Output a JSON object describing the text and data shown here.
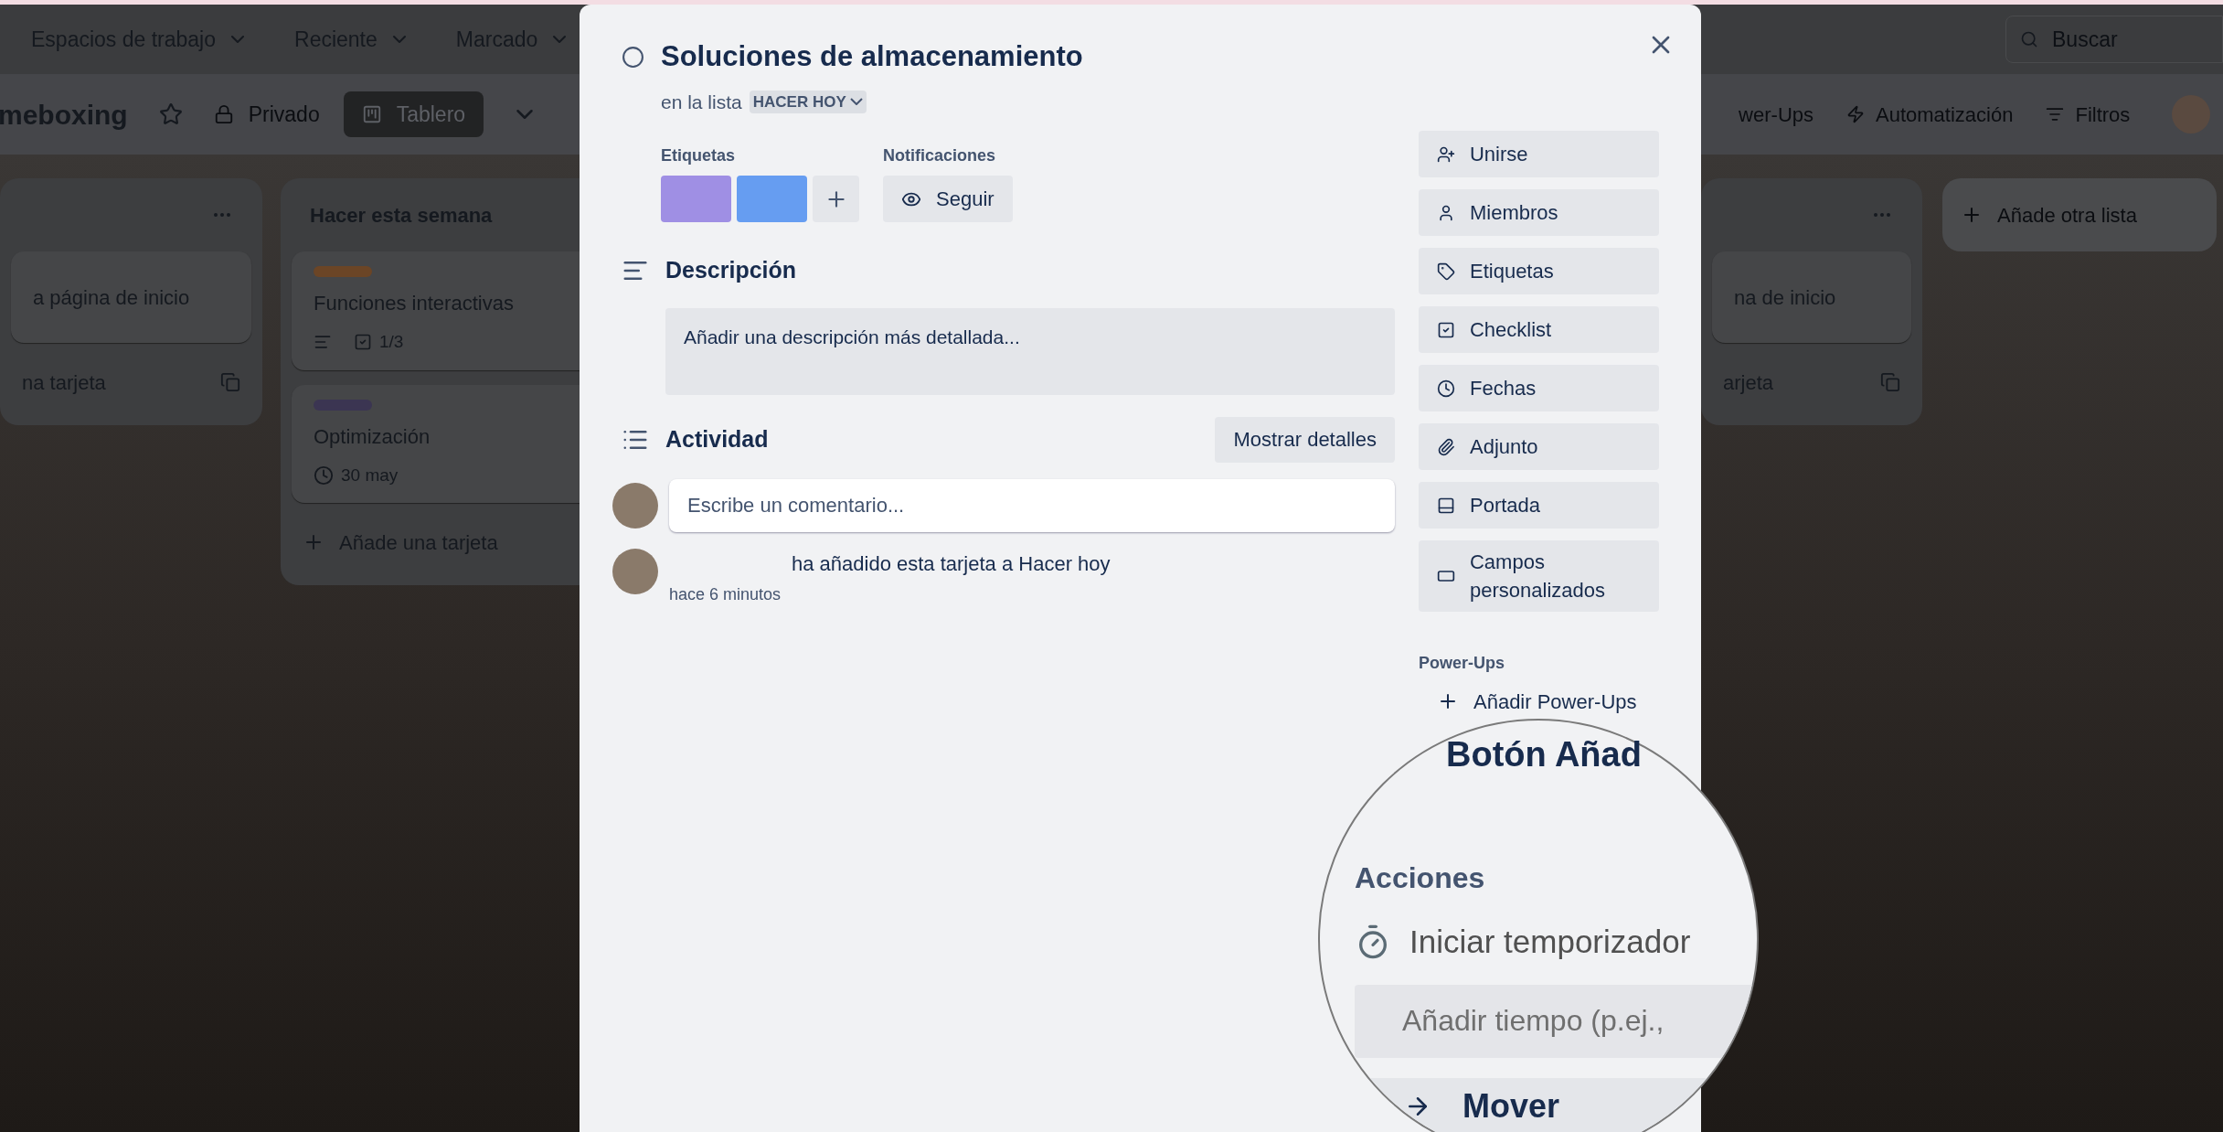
{
  "top_nav": {
    "items": [
      "Espacios de trabajo",
      "Reciente",
      "Marcado"
    ],
    "search": {
      "placeholder": "Buscar"
    }
  },
  "board_header": {
    "title": "meboxing",
    "visibility": "Privado",
    "view": "Tablero",
    "right_items": [
      {
        "kind": "powerups",
        "label": "wer-Ups"
      },
      {
        "kind": "automation",
        "label": "Automatización"
      },
      {
        "kind": "filter",
        "label": "Filtros"
      }
    ]
  },
  "lists": [
    {
      "kind": "cut_left",
      "cards": [
        {
          "title": "a página de inicio"
        }
      ],
      "add_label": "na tarjeta"
    },
    {
      "kind": "full",
      "title": "Hacer esta semana",
      "cards": [
        {
          "title": "Funciones interactivas",
          "color": "#6b4526",
          "badges": [
            {
              "kind": "description"
            },
            {
              "kind": "checklist",
              "text": "1/3"
            }
          ]
        },
        {
          "title": "Optimización",
          "color": "#3b3552",
          "badges": [
            {
              "kind": "date",
              "text": "30 may"
            }
          ]
        }
      ],
      "add_label": "Añade una tarjeta"
    },
    {
      "kind": "cut_left",
      "cards": [
        {
          "title": "na de inicio"
        }
      ],
      "add_label": "arjeta"
    }
  ],
  "add_list": "Añade otra lista",
  "modal": {
    "title": "Soluciones de almacenamiento",
    "list_prefix": "en la lista",
    "list_name": "HACER HOY",
    "labels_heading": "Etiquetas",
    "labels": [
      {
        "color": "#9f8fe4"
      },
      {
        "color": "#669df1"
      }
    ],
    "notifications_heading": "Notificaciones",
    "follow_button": "Seguir",
    "description_heading": "Descripción",
    "description_prompt": "Añadir una descripción más detallada...",
    "activity_heading": "Actividad",
    "details_button": "Mostrar detalles",
    "comment_placeholder": "Escribe un comentario...",
    "activity": [
      {
        "text": "ha añadido esta tarjeta a Hacer hoy",
        "time": "hace 6 minutos"
      }
    ],
    "sidebar_buttons": [
      {
        "kind": "join",
        "label": "Unirse"
      },
      {
        "kind": "members",
        "label": "Miembros"
      },
      {
        "kind": "labels",
        "label": "Etiquetas"
      },
      {
        "kind": "checklist",
        "label": "Checklist"
      },
      {
        "kind": "dates",
        "label": "Fechas"
      },
      {
        "kind": "attachment",
        "label": "Adjunto"
      },
      {
        "kind": "cover",
        "label": "Portada"
      },
      {
        "kind": "custom_fields",
        "label": "Campos personalizados"
      }
    ],
    "powerups_heading": "Power-Ups",
    "add_powerups": "Añadir Power-Ups"
  },
  "magnifier": {
    "partial_title": "Botón Añad",
    "heading": "Acciones",
    "timer_button": "Iniciar temporizador",
    "time_field": {
      "placeholder": "Añadir tiempo (p.ej.,"
    },
    "move_button": "Mover"
  }
}
